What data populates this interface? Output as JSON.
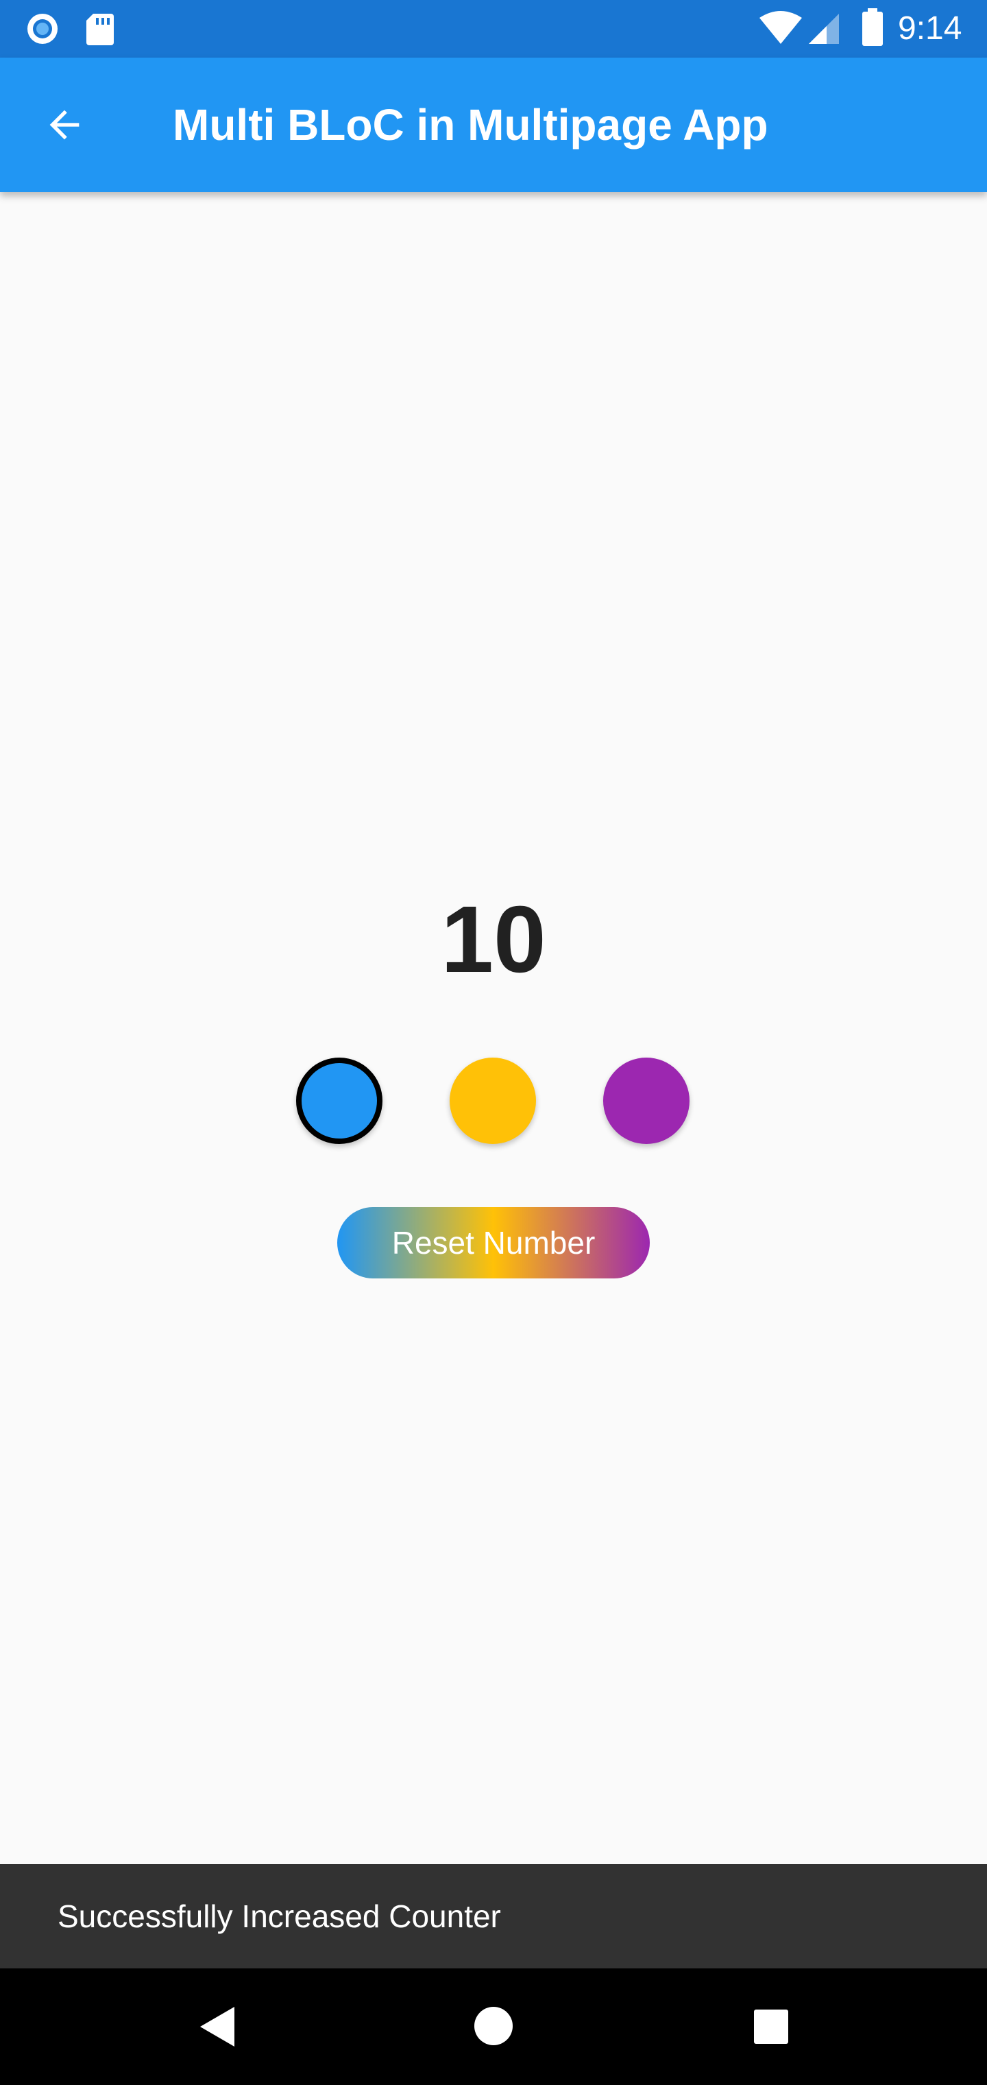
{
  "status_bar": {
    "time": "9:14",
    "icons": [
      "sync-circle-icon",
      "sd-card-icon",
      "wifi-icon",
      "cell-signal-icon",
      "battery-icon"
    ]
  },
  "app_bar": {
    "title": "Multi BLoC in Multipage App",
    "back_icon": "arrow-back-icon"
  },
  "counter": {
    "value": "10"
  },
  "color_options": [
    {
      "name": "blue",
      "color": "#2196F3",
      "selected": true
    },
    {
      "name": "amber",
      "color": "#FFC107",
      "selected": false
    },
    {
      "name": "purple",
      "color": "#9C27B0",
      "selected": false
    }
  ],
  "reset_button": {
    "label": "Reset Number"
  },
  "snackbar": {
    "message": "Successfully Increased Counter"
  },
  "nav_bar": {
    "icons": [
      "nav-back-icon",
      "nav-home-icon",
      "nav-recents-icon"
    ]
  },
  "colors": {
    "status_bar": "#1976D2",
    "app_bar": "#2196F3",
    "background": "#FAFAFA",
    "snackbar": "#323232",
    "nav_bar": "#000000"
  }
}
